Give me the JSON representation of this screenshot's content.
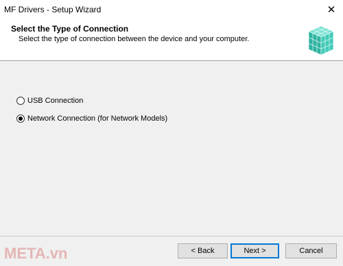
{
  "window": {
    "title": "MF Drivers - Setup Wizard",
    "close_glyph": "✕"
  },
  "header": {
    "title": "Select the Type of Connection",
    "subtitle": "Select the type of connection between the device and your computer.",
    "graphic_icon": "cube-grid-icon"
  },
  "options": [
    {
      "label": "USB Connection",
      "selected": false
    },
    {
      "label": "Network Connection (for Network Models)",
      "selected": true
    }
  ],
  "buttons": {
    "back": "< Back",
    "next": "Next >",
    "cancel": "Cancel"
  },
  "watermark": "META.vn",
  "colors": {
    "accent": "#0078d7",
    "watermark": "#e5b5b5",
    "cube": "#3cc8b4"
  }
}
